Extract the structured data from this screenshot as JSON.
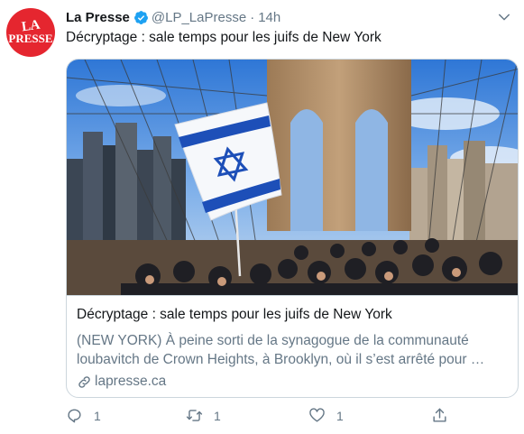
{
  "tweet": {
    "avatar": {
      "line1": "LA",
      "line2": "PRESSE",
      "color": "#e5262f"
    },
    "display_name": "La Presse",
    "handle": "@LP_LaPresse",
    "separator": "·",
    "timestamp": "14h",
    "text": "Décryptage : sale temps pour les juifs de New York",
    "verified_color": "#1da1f2"
  },
  "card": {
    "image_icon": "israeli-flag-brooklyn-bridge-photo",
    "title": "Décryptage : sale temps pour les juifs de New York",
    "description": "(NEW YORK) À peine sorti de la synagogue de la communauté loubavitch de Crown Heights, à Brooklyn, où il s’est arrêté pour …",
    "domain": "lapresse.ca"
  },
  "actions": {
    "reply_count": "1",
    "retweet_count": "1",
    "like_count": "1"
  }
}
